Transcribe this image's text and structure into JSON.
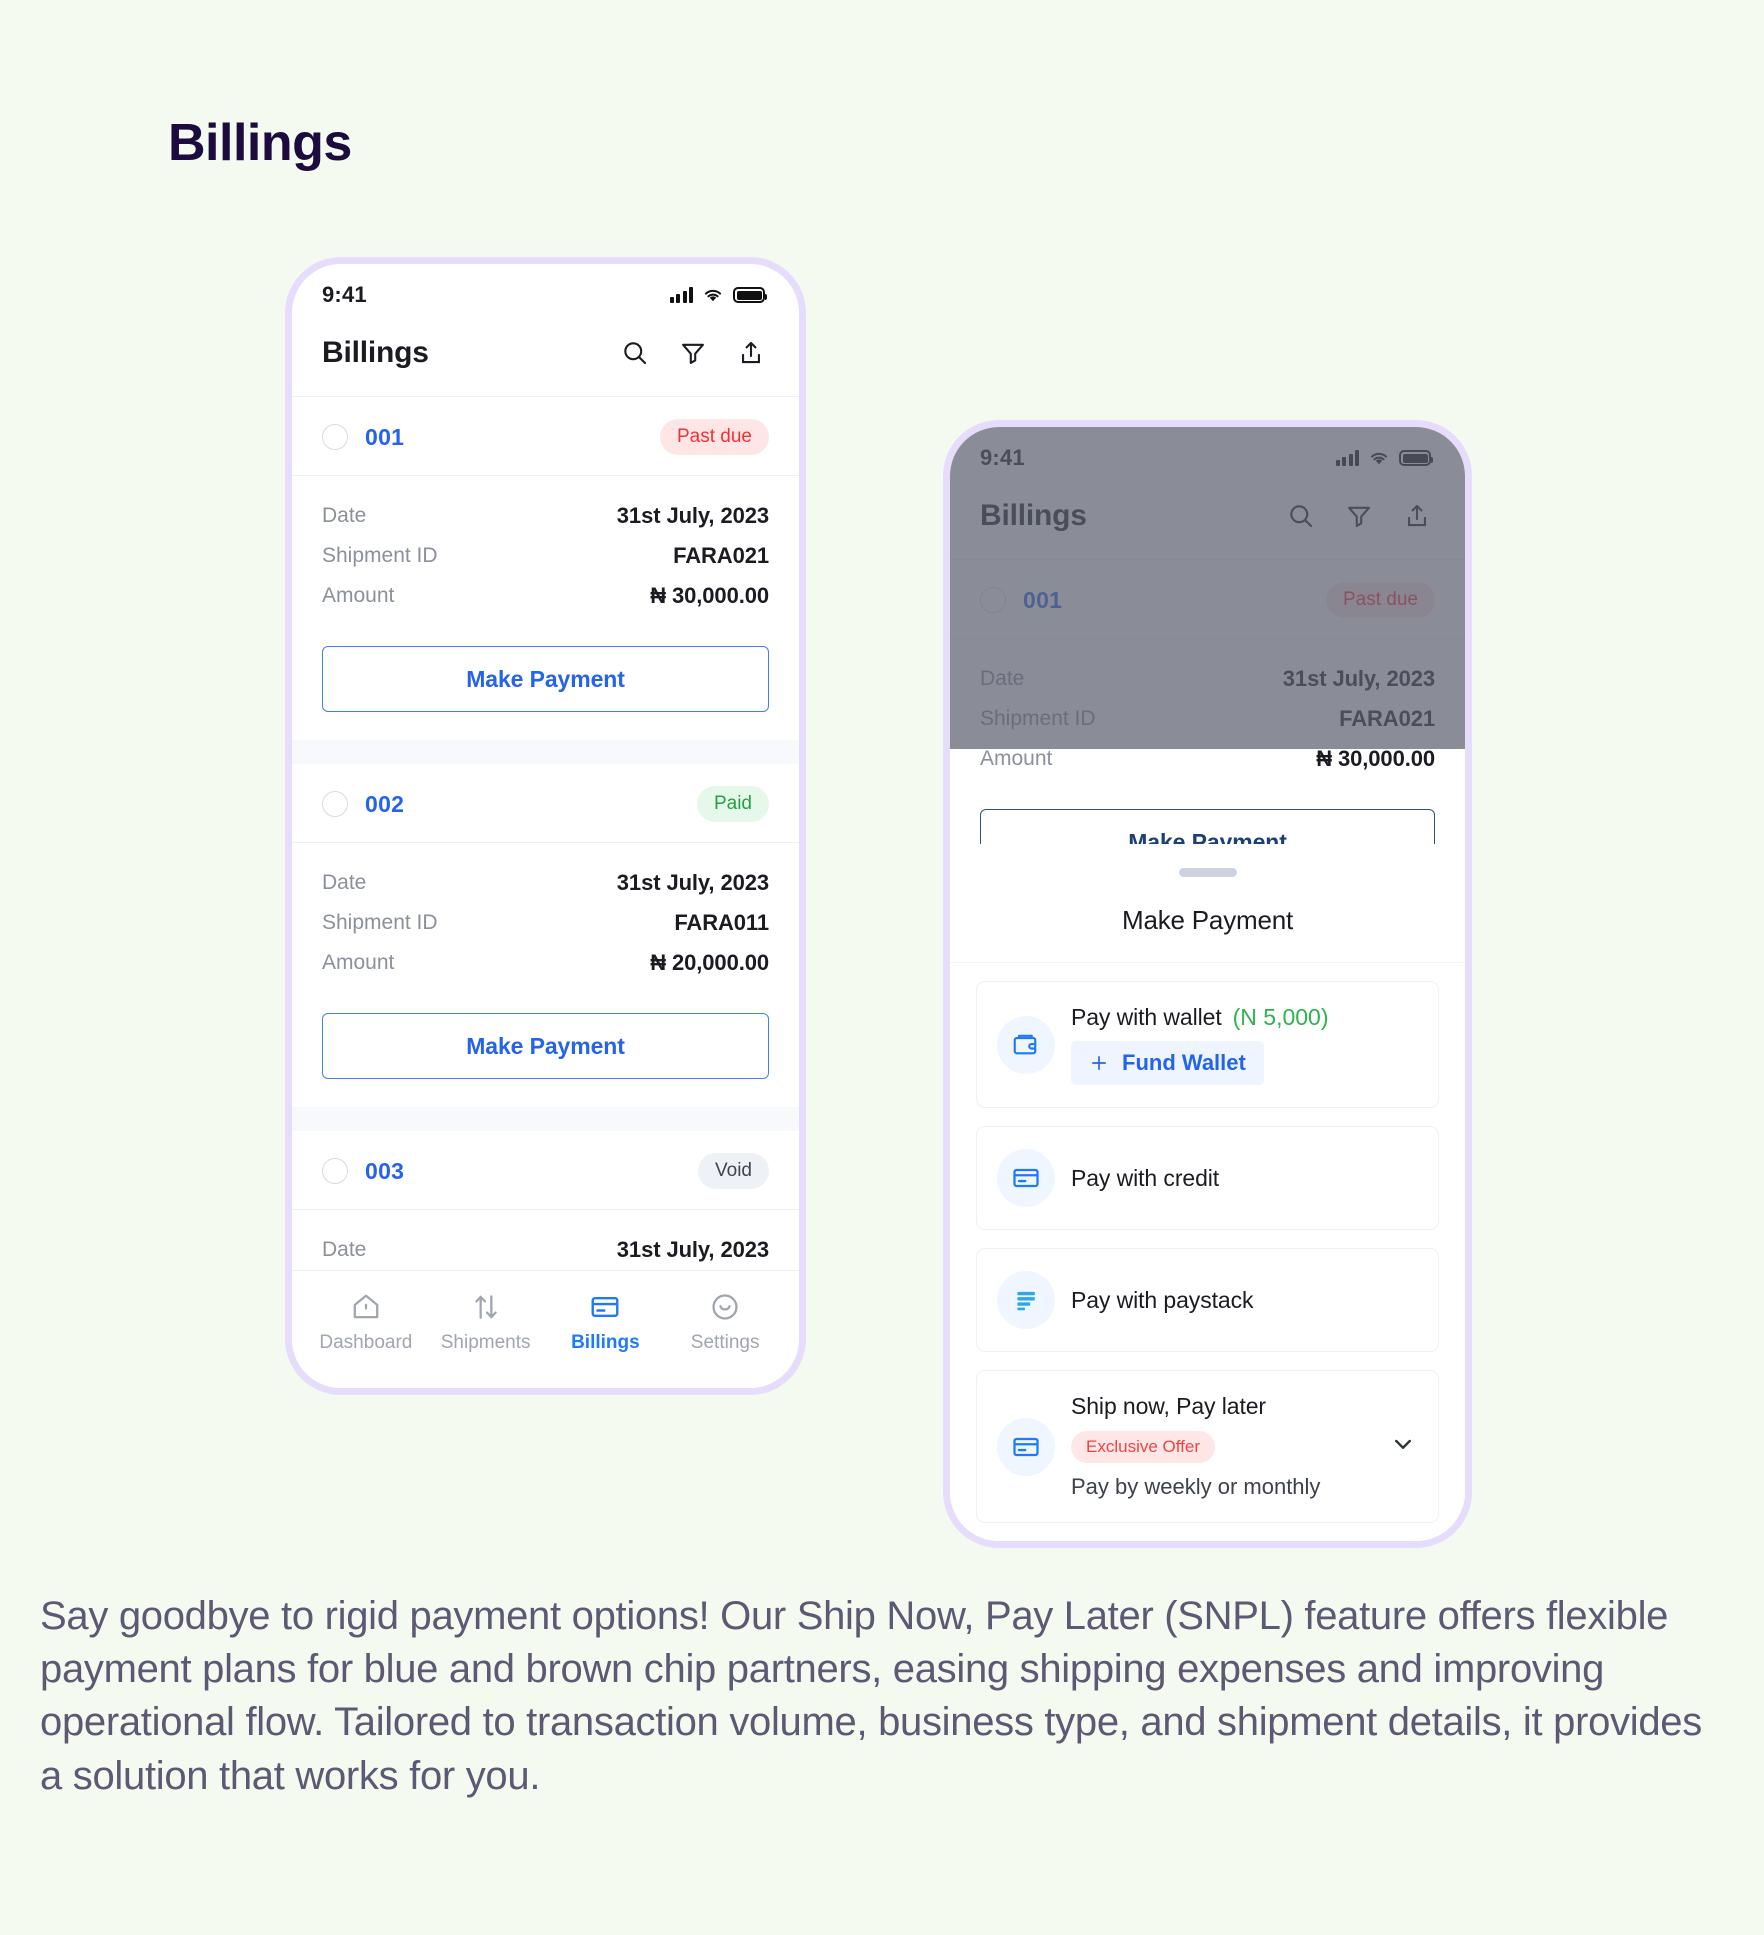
{
  "page": {
    "title": "Billings",
    "background_color": "#f4faef",
    "title_color": "#1d0b40",
    "paragraph": "Say goodbye to rigid payment options! Our Ship Now, Pay Later (SNPL) feature offers flexible payment plans for blue and brown chip partners, easing shipping expenses and improving operational flow. Tailored to transaction volume, business type, and shipment details, it provides a solution that works for you."
  },
  "status_bar": {
    "time": "9:41",
    "icons": [
      "cellular-signal-icon",
      "wifi-icon",
      "battery-icon"
    ]
  },
  "app_header": {
    "title": "Billings",
    "icons": [
      "search-icon",
      "filter-icon",
      "share-icon"
    ]
  },
  "billings": [
    {
      "id": "001",
      "status": "Past due",
      "status_kind": "pastdue",
      "rows": [
        {
          "label": "Date",
          "value": "31st July, 2023"
        },
        {
          "label": "Shipment ID",
          "value": "FARA021"
        },
        {
          "label": "Amount",
          "value": "₦ 30,000.00"
        }
      ],
      "action": "Make Payment"
    },
    {
      "id": "002",
      "status": "Paid",
      "status_kind": "paid",
      "rows": [
        {
          "label": "Date",
          "value": "31st July, 2023"
        },
        {
          "label": "Shipment ID",
          "value": "FARA011"
        },
        {
          "label": "Amount",
          "value": "₦ 20,000.00"
        }
      ],
      "action": "Make Payment"
    },
    {
      "id": "003",
      "status": "Void",
      "status_kind": "void",
      "rows": [
        {
          "label": "Date",
          "value": "31st July, 2023"
        }
      ]
    }
  ],
  "bottom_nav": {
    "items": [
      {
        "label": "Dashboard",
        "icon": "home-icon",
        "active": false
      },
      {
        "label": "Shipments",
        "icon": "transfer-arrows-icon",
        "active": false
      },
      {
        "label": "Billings",
        "icon": "credit-card-icon",
        "active": true
      },
      {
        "label": "Settings",
        "icon": "smiley-face-icon",
        "active": false
      }
    ],
    "active_color": "#1d7afc",
    "inactive_color": "#a0a5af"
  },
  "payment_sheet": {
    "title": "Make Payment",
    "options": [
      {
        "title": "Pay with wallet",
        "amount": "(N 5,000)",
        "icon": "wallet-icon",
        "action_label": "Fund Wallet",
        "action_icon": "plus-icon"
      },
      {
        "title": "Pay with credit",
        "icon": "credit-card-icon"
      },
      {
        "title": "Pay with paystack",
        "icon": "paystack-icon"
      },
      {
        "title": "Ship now, Pay later",
        "badge": "Exclusive Offer",
        "subtitle": "Pay by weekly or monthly",
        "icon": "credit-card-icon",
        "expand_icon": "chevron-down-icon"
      }
    ]
  },
  "colors": {
    "accent_blue": "#2563eb",
    "status_red": "#f82f2f",
    "status_green": "#22a148",
    "wallet_green": "#2fb34f",
    "scrim": "#5d6170",
    "phone_border": "#e6dcfb"
  }
}
